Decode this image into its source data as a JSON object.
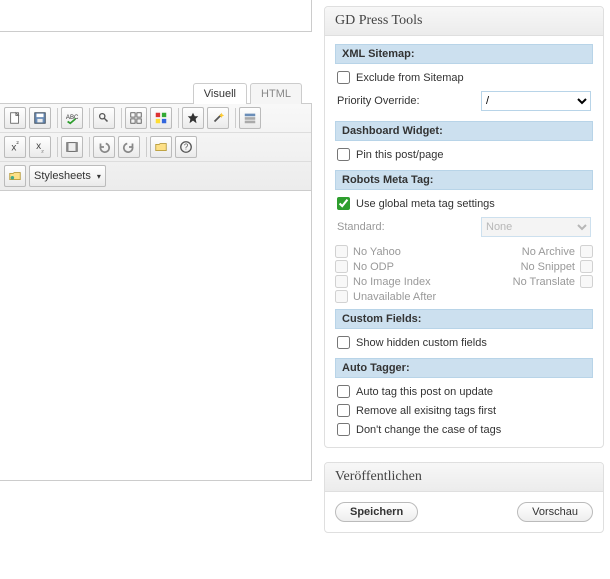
{
  "editor": {
    "tabs": {
      "visual": "Visuell",
      "html": "HTML"
    },
    "stylesheets_label": "Stylesheets"
  },
  "gd": {
    "title": "GD Press Tools",
    "xml_sitemap": {
      "head": "XML Sitemap:",
      "exclude": "Exclude from Sitemap"
    },
    "priority": {
      "label": "Priority Override:",
      "value": "/"
    },
    "dashboard": {
      "head": "Dashboard Widget:",
      "pin": "Pin this post/page"
    },
    "robots": {
      "head": "Robots Meta Tag:",
      "use_global": "Use global meta tag settings",
      "standard_label": "Standard:",
      "standard_value": "None",
      "no_yahoo": "No Yahoo",
      "no_archive": "No Archive",
      "no_odp": "No ODP",
      "no_snippet": "No Snippet",
      "no_image": "No Image Index",
      "no_translate": "No Translate",
      "unavailable": "Unavailable After"
    },
    "custom_fields": {
      "head": "Custom Fields:",
      "show_hidden": "Show hidden custom fields"
    },
    "auto_tagger": {
      "head": "Auto Tagger:",
      "auto_tag": "Auto tag this post on update",
      "remove_existing": "Remove all exisitng tags first",
      "dont_change_case": "Don't change the case of tags"
    }
  },
  "publish": {
    "title": "Veröffentlichen",
    "save": "Speichern",
    "preview": "Vorschau"
  }
}
